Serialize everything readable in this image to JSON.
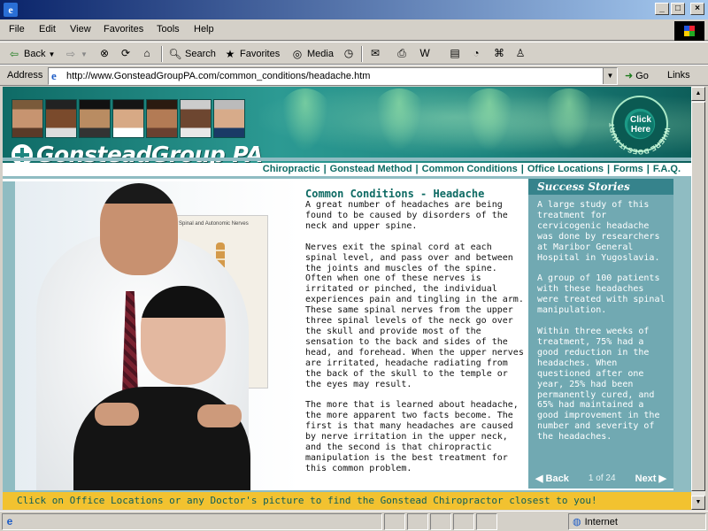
{
  "window": {
    "minimize": "_",
    "maximize": "□",
    "close": "×"
  },
  "menu": [
    "File",
    "Edit",
    "View",
    "Favorites",
    "Tools",
    "Help"
  ],
  "toolbar": {
    "back": "Back",
    "search": "Search",
    "favorites": "Favorites",
    "media": "Media"
  },
  "address": {
    "label": "Address",
    "url": "http://www.GonsteadGroupPA.com/common_conditions/headache.htm",
    "go": "Go",
    "links": "Links"
  },
  "site": {
    "logo": "GonsteadGroup PA",
    "click_here": "Click Here",
    "ring_text": "WHERE DOES IT HURT?",
    "nav": [
      "Chiropractic",
      "Gonstead Method",
      "Common Conditions",
      "Office Locations",
      "Forms",
      "F.A.Q."
    ],
    "heading": "Common Conditions - Headache",
    "paragraphs": [
      "A great number of headaches are being found to be caused by disorders of the neck and upper spine.",
      "Nerves exit the spinal cord at each spinal level, and pass over and between the joints and muscles of the spine. Often when one of these nerves is irritated or pinched, the individual experiences pain and tingling in the arm. These same spinal nerves from the upper three spinal levels of the neck go over the skull and provide most of the sensation to the back and sides of the head, and forehead. When the upper nerves are irritated, headache radiating from the back of the skull to the temple or the eyes may result.",
      "The more that is learned about headache, the more apparent two facts become. The first is that many headaches are caused by nerve irritation in the upper neck, and the second is that chiropractic manipulation is the best treatment for this common problem."
    ],
    "poster_title": "Spinal and Autonomic Nerves",
    "sidebar": {
      "title": "Success Stories",
      "paragraphs": [
        "A large study of this treatment for cervicogenic headache was done by researchers at Maribor General Hospital in Yugoslavia.",
        "A group of 100 patients with these headaches were treated with spinal manipulation.",
        "Within three weeks of treatment, 75% had a good reduction in the headaches. When questioned after one year, 25% had been permanently cured, and 65% had maintained a good improvement in the number and severity of the headaches."
      ],
      "back": "◀ Back",
      "pager": "1 of 24",
      "next": "Next ▶"
    },
    "footer": "Click on Office Locations or any Doctor's picture to find the Gonstead Chiropractor closest to you!"
  },
  "status": {
    "zone": "Internet"
  },
  "colors": {
    "brand_teal": "#1d857f",
    "sidebar": "#71a9b2",
    "footer": "#f2c230"
  }
}
